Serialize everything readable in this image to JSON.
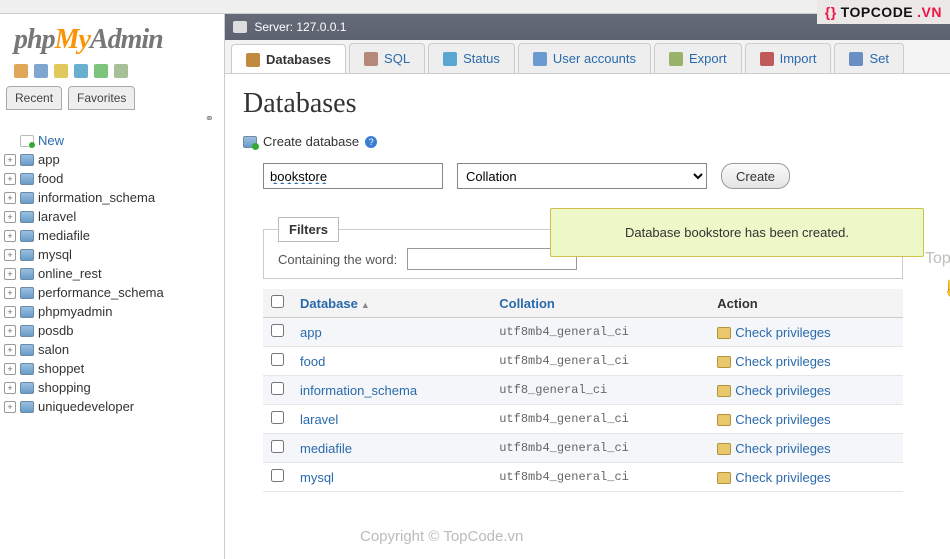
{
  "brand": {
    "p1": "php",
    "p2": "My",
    "p3": "Admin"
  },
  "sidebarTabs": {
    "recent": "Recent",
    "fav": "Favorites"
  },
  "tree": [
    {
      "label": "New",
      "new": true,
      "expand": false
    },
    {
      "label": "app"
    },
    {
      "label": "food"
    },
    {
      "label": "information_schema"
    },
    {
      "label": "laravel"
    },
    {
      "label": "mediafile"
    },
    {
      "label": "mysql"
    },
    {
      "label": "online_rest"
    },
    {
      "label": "performance_schema"
    },
    {
      "label": "phpmyadmin"
    },
    {
      "label": "posdb"
    },
    {
      "label": "salon"
    },
    {
      "label": "shoppet"
    },
    {
      "label": "shopping"
    },
    {
      "label": "uniquedeveloper"
    }
  ],
  "server": {
    "prefix": "Server:",
    "host": "127.0.0.1"
  },
  "tabs": [
    {
      "label": "Databases",
      "name": "databases",
      "active": true,
      "color": "#c08b3f"
    },
    {
      "label": "SQL",
      "name": "sql",
      "color": "#b4897a"
    },
    {
      "label": "Status",
      "name": "status",
      "color": "#5aa6d2"
    },
    {
      "label": "User accounts",
      "name": "user-accounts",
      "color": "#6b9ad0"
    },
    {
      "label": "Export",
      "name": "export",
      "color": "#9ab36a"
    },
    {
      "label": "Import",
      "name": "import",
      "color": "#c05a5a"
    },
    {
      "label": "Set",
      "name": "settings",
      "color": "#6a8fc4"
    }
  ],
  "page": {
    "title": "Databases",
    "createLabel": "Create database",
    "dbNameValue": "bookstore",
    "collationPlaceholder": "Collation",
    "createBtn": "Create",
    "notification": "Database bookstore has been created.",
    "filtersLabel": "Filters",
    "containingLabel": "Containing the word:"
  },
  "tableHead": {
    "col1": "Database",
    "col2": "Collation",
    "col3": "Action"
  },
  "rows": [
    {
      "db": "app",
      "coll": "utf8mb4_general_ci",
      "action": "Check privileges"
    },
    {
      "db": "food",
      "coll": "utf8mb4_general_ci",
      "action": "Check privileges"
    },
    {
      "db": "information_schema",
      "coll": "utf8_general_ci",
      "action": "Check privileges"
    },
    {
      "db": "laravel",
      "coll": "utf8mb4_general_ci",
      "action": "Check privileges"
    },
    {
      "db": "mediafile",
      "coll": "utf8mb4_general_ci",
      "action": "Check privileges"
    },
    {
      "db": "mysql",
      "coll": "utf8mb4_general_ci",
      "action": "Check privileges"
    }
  ],
  "watermark": {
    "topRight1": "{}",
    "topRight2": "TOPCODE",
    "topRight3": ".VN",
    "mid1": "TopCode.vn",
    "mid2": "Copyright © TopCode.vn"
  }
}
